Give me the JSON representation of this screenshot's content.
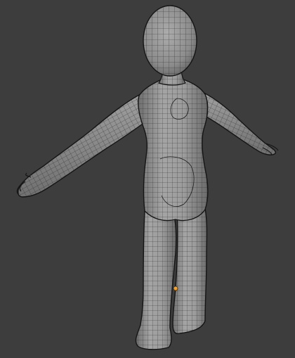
{
  "viewport": {
    "background": "#3d3d3d",
    "mode": "wireframe-overlay"
  },
  "mesh": {
    "object": "humanoid-base-mesh",
    "pose": "T-pose",
    "surface_color": "#9a9a9a",
    "wire_color": "#1e1e1e",
    "silhouette_color": "#151515"
  },
  "origin": {
    "icon": "object-origin-dot",
    "color": "#f0a030"
  }
}
